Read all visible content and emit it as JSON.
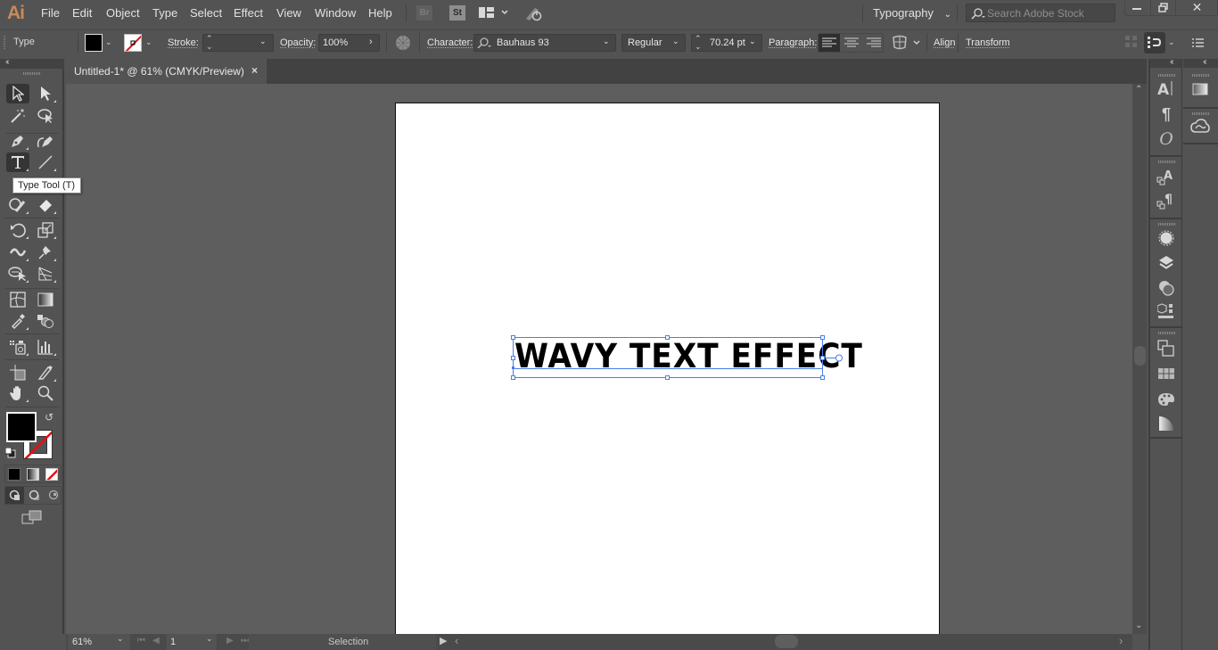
{
  "app": {
    "logo": "Ai"
  },
  "menu": [
    "File",
    "Edit",
    "Object",
    "Type",
    "Select",
    "Effect",
    "View",
    "Window",
    "Help"
  ],
  "menubar_right": {
    "bridge_label": "Br",
    "stock_label": "St",
    "workspace": "Typography",
    "search_placeholder": "Search Adobe Stock"
  },
  "controlbar": {
    "selection_type": "Type",
    "stroke_label": "Stroke:",
    "stroke_value": "",
    "opacity_label": "Opacity:",
    "opacity_value": "100%",
    "character_label": "Character:",
    "font_family": "Bauhaus 93",
    "font_style": "Regular",
    "font_size": "70.24 pt",
    "paragraph_label": "Paragraph:",
    "align_label": "Align",
    "transform_label": "Transform"
  },
  "document": {
    "tab_title": "Untitled-1* @ 61% (CMYK/Preview)",
    "close_glyph": "×"
  },
  "tooltip": "Type Tool (T)",
  "artboard": {
    "text": "WAVY TEXT EFFECT"
  },
  "statusbar": {
    "zoom": "61%",
    "artboard_number": "1",
    "status_text": "Selection"
  },
  "colors": {
    "fill": "#000000",
    "stroke": "none",
    "selection_accent": "#4a7ee8"
  }
}
